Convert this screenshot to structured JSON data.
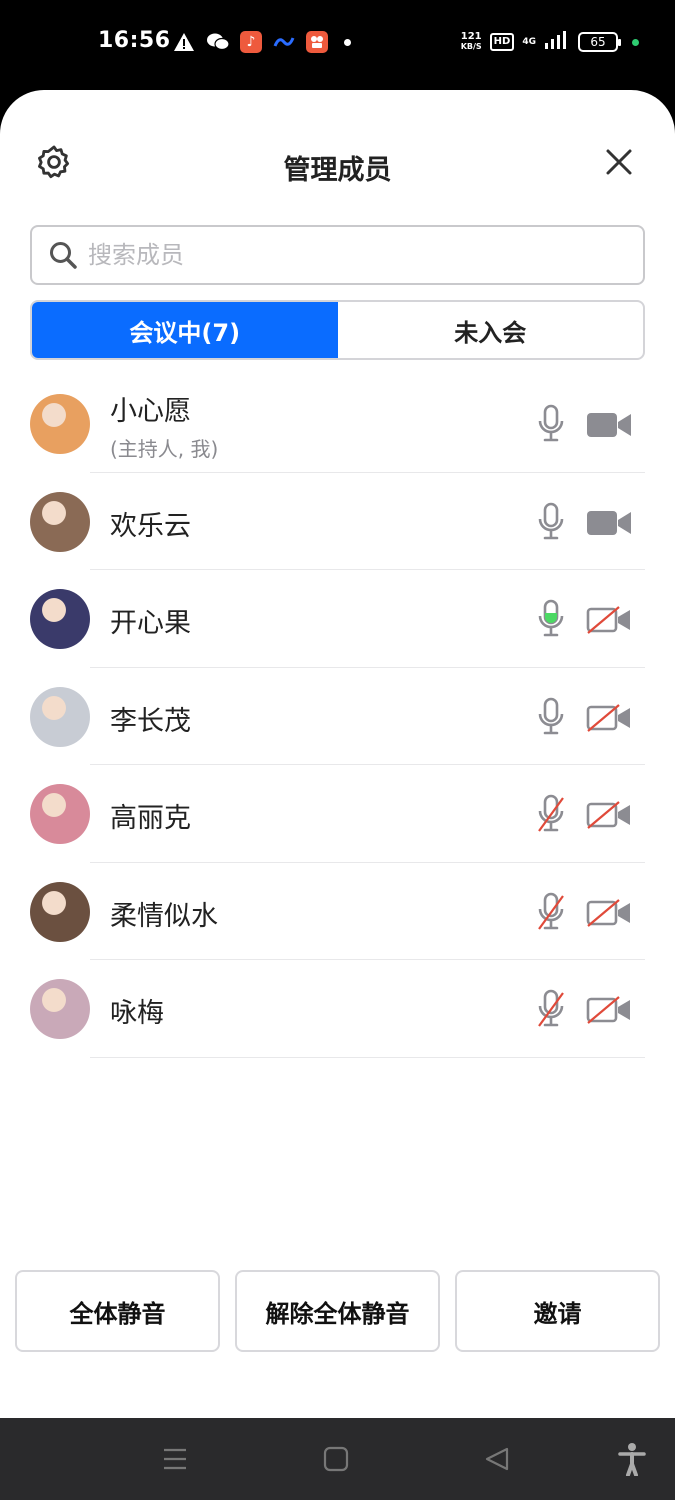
{
  "status_bar": {
    "time": "16:56",
    "net_speed_value": "121",
    "net_speed_unit": "KB/S",
    "hd": "HD",
    "network": "4G",
    "battery": "65"
  },
  "header": {
    "title": "管理成员",
    "settings_icon": "gear-icon",
    "close_icon": "close-icon"
  },
  "search": {
    "placeholder": "搜索成员",
    "value": ""
  },
  "tabs": [
    {
      "label": "会议中(7)",
      "active": true
    },
    {
      "label": "未入会",
      "active": false
    }
  ],
  "members": [
    {
      "name": "小心愿",
      "role": "(主持人, 我)",
      "mic": "on",
      "camera": "on",
      "avatar_color": "#e8a060"
    },
    {
      "name": "欢乐云",
      "role": "",
      "mic": "on",
      "camera": "on",
      "avatar_color": "#8a6a55"
    },
    {
      "name": "开心果",
      "role": "",
      "mic": "speaking",
      "camera": "off",
      "avatar_color": "#3a3a6a"
    },
    {
      "name": "李长茂",
      "role": "",
      "mic": "on",
      "camera": "off",
      "avatar_color": "#c8ccd4"
    },
    {
      "name": "高丽克",
      "role": "",
      "mic": "muted",
      "camera": "off",
      "avatar_color": "#d88a9a"
    },
    {
      "name": "柔情似水",
      "role": "",
      "mic": "muted",
      "camera": "off",
      "avatar_color": "#6b5040"
    },
    {
      "name": "咏梅",
      "role": "",
      "mic": "muted",
      "camera": "off",
      "avatar_color": "#c9a9b8"
    }
  ],
  "actions": {
    "mute_all": "全体静音",
    "unmute_all": "解除全体静音",
    "invite": "邀请"
  },
  "colors": {
    "accent": "#0a6cff",
    "icon_gray": "#8c8c92",
    "muted_red": "#e04a3a",
    "speaking_green": "#4cd964"
  }
}
